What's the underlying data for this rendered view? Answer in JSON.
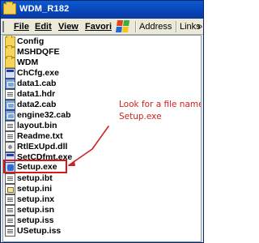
{
  "window": {
    "title": "WDM_R182"
  },
  "menu": {
    "file": "File",
    "edit": "Edit",
    "view": "View",
    "favorites": "Favori",
    "address": "Address",
    "links": "Links",
    "more": "»"
  },
  "files": [
    {
      "name": "Config",
      "icon": "folder-icon"
    },
    {
      "name": "MSHDQFE",
      "icon": "folder-icon"
    },
    {
      "name": "WDM",
      "icon": "folder-icon"
    },
    {
      "name": "ChCfg.exe",
      "icon": "exe-icon"
    },
    {
      "name": "data1.cab",
      "icon": "cab-icon"
    },
    {
      "name": "data1.hdr",
      "icon": "doc-icon"
    },
    {
      "name": "data2.cab",
      "icon": "cab-icon"
    },
    {
      "name": "engine32.cab",
      "icon": "cab-icon"
    },
    {
      "name": "layout.bin",
      "icon": "doc-icon"
    },
    {
      "name": "Readme.txt",
      "icon": "doc-icon"
    },
    {
      "name": "RtlExUpd.dll",
      "icon": "dll-icon"
    },
    {
      "name": "SetCDfmt.exe",
      "icon": "exe-icon"
    },
    {
      "name": "Setup.exe",
      "icon": "setup-icon"
    },
    {
      "name": "setup.ibt",
      "icon": "doc-icon"
    },
    {
      "name": "setup.ini",
      "icon": "ini-icon"
    },
    {
      "name": "setup.inx",
      "icon": "doc-icon"
    },
    {
      "name": "setup.isn",
      "icon": "doc-icon"
    },
    {
      "name": "setup.iss",
      "icon": "doc-icon"
    },
    {
      "name": "USetup.iss",
      "icon": "doc-icon"
    }
  ],
  "annotation": {
    "line1": "Look for a file named",
    "line2": "Setup.exe",
    "color": "#d02020"
  },
  "colors": {
    "titlebar": "#0a46c0",
    "highlight": "#d81818"
  }
}
